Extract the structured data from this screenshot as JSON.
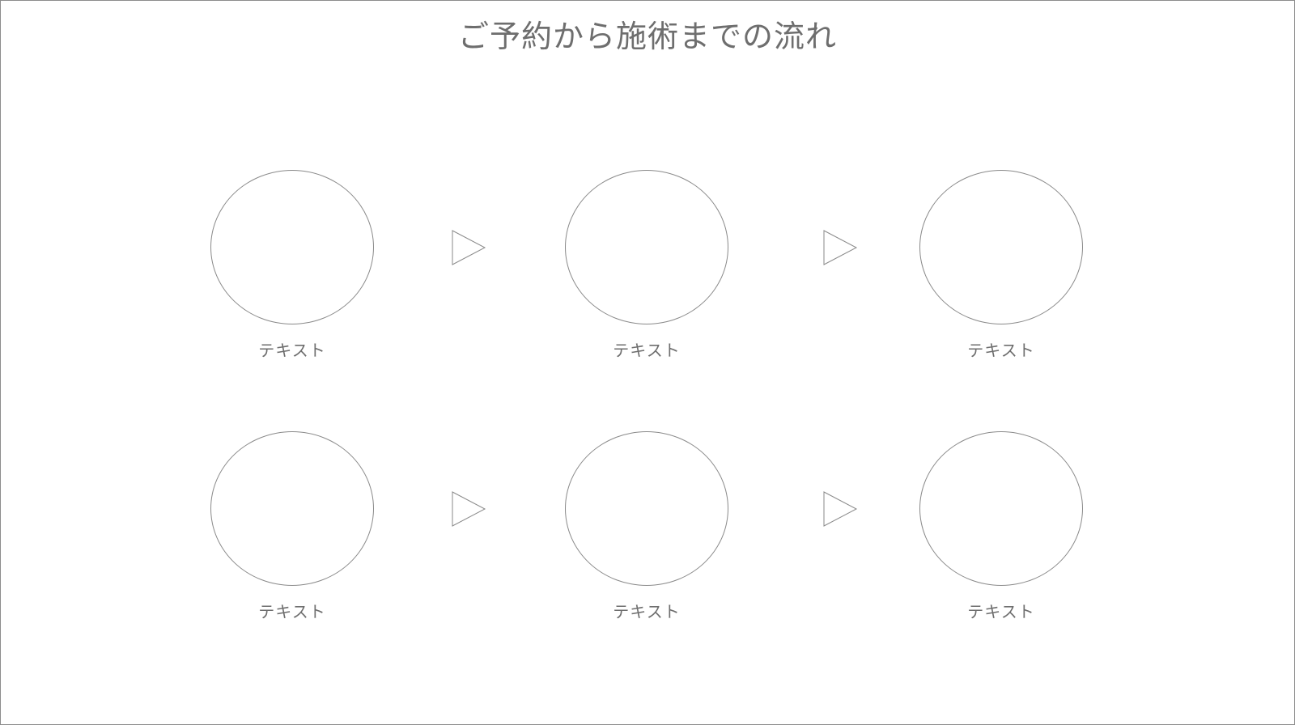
{
  "title": "ご予約から施術までの流れ",
  "steps": [
    {
      "label": "テキスト"
    },
    {
      "label": "テキスト"
    },
    {
      "label": "テキスト"
    },
    {
      "label": "テキスト"
    },
    {
      "label": "テキスト"
    },
    {
      "label": "テキスト"
    }
  ],
  "colors": {
    "text": "#6e6e6e",
    "stroke": "#8a8a8a",
    "background": "#ffffff"
  },
  "icons": {
    "arrow": "triangle-right-outline-icon"
  }
}
